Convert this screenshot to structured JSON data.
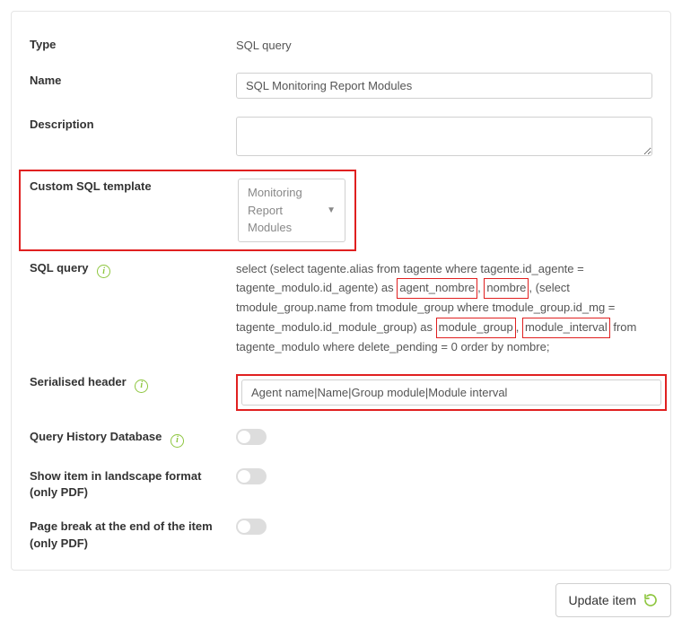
{
  "labels": {
    "type": "Type",
    "name": "Name",
    "description": "Description",
    "custom_sql_template": "Custom SQL template",
    "sql_query": "SQL query",
    "serialised_header": "Serialised header",
    "query_history_db": "Query History Database",
    "landscape": "Show item in landscape format (only PDF)",
    "page_break": "Page break at the end of the item (only PDF)"
  },
  "values": {
    "type": "SQL query",
    "name": "SQL Monitoring Report Modules",
    "description": "",
    "custom_sql_template_selected": "Monitoring Report Modules",
    "serialised_header": "Agent name|Name|Group module|Module interval",
    "query_history_db": false,
    "landscape": false,
    "page_break": false
  },
  "sql_parts": {
    "p1": "select (select tagente.alias from tagente where tagente.id_agente = tagente_modulo.id_agente) as ",
    "t1": "agent_nombre",
    "sep1": ", ",
    "t2": "nombre",
    "p2": ", (select tmodule_group.name from tmodule_group where tmodule_group.id_mg = tagente_modulo.id_module_group) as ",
    "t3": "module_group",
    "sep2": ", ",
    "t4": "module_interval",
    "p3": " from tagente_modulo where delete_pending = 0 order by nombre;"
  },
  "buttons": {
    "update": "Update item"
  },
  "icons": {
    "info": "i",
    "caret": "▼"
  }
}
